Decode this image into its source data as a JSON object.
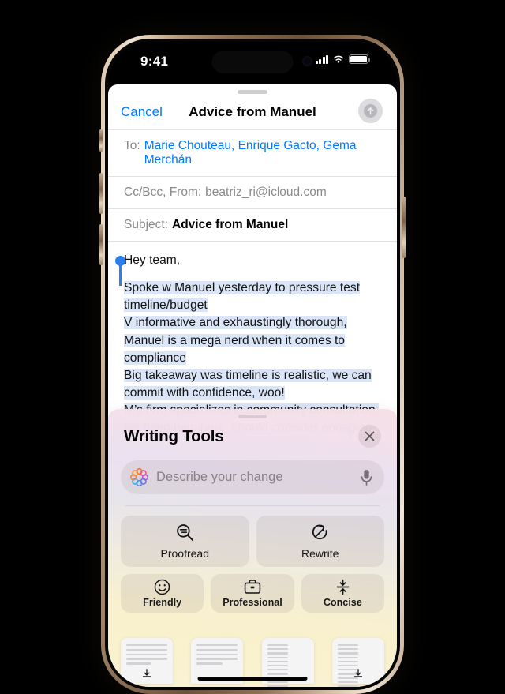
{
  "status_bar": {
    "time": "9:41",
    "signal_icon": "cellular-bars-icon",
    "wifi_icon": "wifi-icon",
    "battery_icon": "battery-icon"
  },
  "compose": {
    "cancel_label": "Cancel",
    "title": "Advice from Manuel",
    "send_icon": "send-arrow-up-icon",
    "fields": {
      "to_label": "To:",
      "to_value": "Marie Chouteau, Enrique Gacto, Gema Merchán",
      "cc_label": "Cc/Bcc, From:",
      "cc_value": "beatriz_ri@icloud.com",
      "subject_label": "Subject:",
      "subject_value": "Advice from Manuel"
    },
    "body": {
      "greeting": "Hey team,",
      "selected_lines": [
        "Spoke w Manuel yesterday to pressure test",
        "timeline/budget",
        "V informative and exhaustingly thorough,",
        "Manuel is a mega nerd when it comes to",
        "compliance",
        "Big takeaway was timeline is realistic, we can",
        "commit with confidence, woo!",
        "M’s firm specializes in community consultation,",
        "we need help here, should consider engaging"
      ]
    }
  },
  "writing_tools": {
    "title": "Writing Tools",
    "close_icon": "close-x-icon",
    "ai_icon": "apple-intelligence-icon",
    "mic_icon": "microphone-icon",
    "describe_placeholder": "Describe your change",
    "describe_value": "",
    "main_actions": [
      {
        "label": "Proofread",
        "icon": "magnifier-lines-icon"
      },
      {
        "label": "Rewrite",
        "icon": "circle-arrow-rewrite-icon"
      }
    ],
    "tone_actions": [
      {
        "label": "Friendly",
        "icon": "smiley-face-icon"
      },
      {
        "label": "Professional",
        "icon": "briefcase-icon"
      },
      {
        "label": "Concise",
        "icon": "compress-arrows-icon"
      }
    ],
    "doc_cards": [
      {
        "name": "summary-card",
        "style": "lines",
        "has_download": true
      },
      {
        "name": "key-points-card",
        "style": "lines",
        "has_download": false
      },
      {
        "name": "list-card",
        "style": "dense",
        "has_download": false
      },
      {
        "name": "table-card",
        "style": "dense",
        "has_download": true
      }
    ]
  },
  "colors": {
    "accent_blue": "#007aff",
    "selection_blue": "#dae6f7",
    "handle_blue": "#2d7ff0"
  }
}
